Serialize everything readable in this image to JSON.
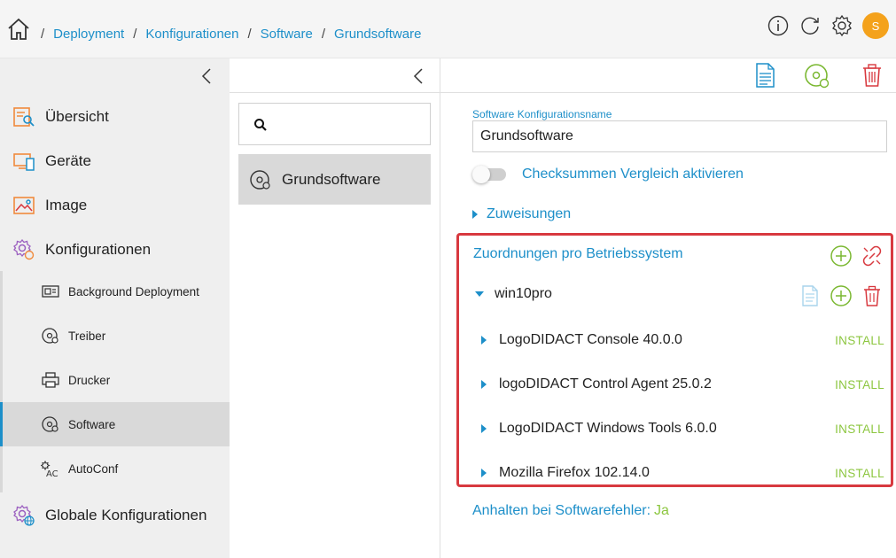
{
  "breadcrumb": {
    "home_icon": "home-icon",
    "items": [
      "Deployment",
      "Konfigurationen",
      "Software",
      "Grundsoftware"
    ],
    "separator": "/"
  },
  "topbar": {
    "icons": [
      "info-icon",
      "refresh-icon",
      "settings-gear-icon"
    ],
    "avatar_letter": "S",
    "avatar_color": "#f4a21c"
  },
  "sidebar": {
    "main_items": [
      {
        "label": "Übersicht",
        "icon": "overview-icon"
      },
      {
        "label": "Geräte",
        "icon": "devices-icon"
      },
      {
        "label": "Image",
        "icon": "image-icon"
      },
      {
        "label": "Konfigurationen",
        "icon": "configurations-icon"
      }
    ],
    "sub_items": [
      {
        "label": "Background Deployment",
        "icon": "background-deployment-icon"
      },
      {
        "label": "Treiber",
        "icon": "driver-disc-icon"
      },
      {
        "label": "Drucker",
        "icon": "printer-icon"
      },
      {
        "label": "Software",
        "icon": "software-disc-icon",
        "active": true
      },
      {
        "label": "AutoConf",
        "icon": "autoconf-icon"
      }
    ],
    "global_item": {
      "label": "Globale Konfigurationen",
      "icon": "global-config-icon"
    }
  },
  "list": {
    "search_placeholder": "",
    "items": [
      {
        "label": "Grundsoftware",
        "icon": "software-disc-icon"
      }
    ]
  },
  "toolbar": {
    "icons": [
      "document-icon",
      "deploy-disc-icon",
      "delete-icon"
    ]
  },
  "form": {
    "name_label": "Software Konfigurationsname",
    "name_value": "Grundsoftware",
    "checksum_label": "Checksummen Vergleich aktivieren",
    "checksum_enabled": false,
    "assignments_label": "Zuweisungen"
  },
  "os_box": {
    "title": "Zuordnungen pro Betriebssystem",
    "os_name": "win10pro",
    "software": [
      {
        "name": "LogoDIDACT Console 40.0.0",
        "action": "INSTALL"
      },
      {
        "name": "logoDIDACT Control Agent 25.0.2",
        "action": "INSTALL"
      },
      {
        "name": "LogoDIDACT Windows Tools 6.0.0",
        "action": "INSTALL"
      },
      {
        "name": "Mozilla Firefox 102.14.0",
        "action": "INSTALL"
      }
    ]
  },
  "halt": {
    "label": "Anhalten bei Softwarefehler:",
    "value": "Ja"
  },
  "colors": {
    "accent": "#1d8fc9",
    "green": "#8cc63f",
    "red": "#d8393f",
    "icon_orange": "#f08a3c"
  }
}
